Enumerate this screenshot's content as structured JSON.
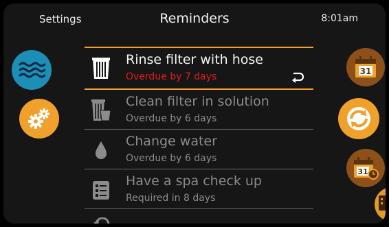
{
  "header": {
    "settings_label": "Settings",
    "title": "Reminders",
    "time": "8:01am"
  },
  "reminders": [
    {
      "title": "Rinse filter with hose",
      "status": "Overdue by 7 days",
      "icon": "filter-icon",
      "active": true
    },
    {
      "title": "Clean filter in solution",
      "status": "Overdue by 6 days",
      "icon": "filter-bucket-icon",
      "active": false
    },
    {
      "title": "Change water",
      "status": "Overdue by 6 days",
      "icon": "water-drop-icon",
      "active": false
    },
    {
      "title": "Have a spa check up",
      "status": "Required in 8 days",
      "icon": "checklist-icon",
      "active": false
    }
  ],
  "side_buttons": {
    "calendar_day": "31",
    "calendar_day_2": "31"
  },
  "colors": {
    "accent_orange": "#f0a12c",
    "overdue_red": "#e01c1c",
    "water_blue": "#1d8fb6",
    "dark_orange": "#8d5019"
  }
}
